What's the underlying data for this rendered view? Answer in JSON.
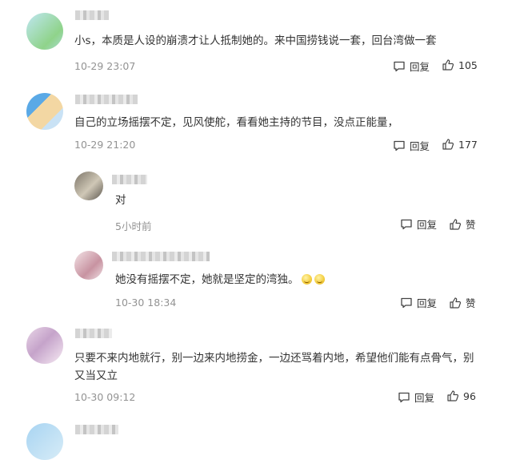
{
  "comments": [
    {
      "text": "小s，本质是人设的崩溃才让人抵制她的。来中国捞钱说一套，回台湾做一套",
      "time": "10-29 23:07",
      "reply_label": "回复",
      "like_value": "105",
      "avatar_colors": [
        "#8fd38a",
        "#bde8f4"
      ]
    },
    {
      "text": "自己的立场摇摆不定，见风使舵，看看她主持的节目，没点正能量，",
      "time": "10-29 21:20",
      "reply_label": "回复",
      "like_value": "177",
      "avatar_colors": [
        "#6fb8ea",
        "#f6d9a8"
      ]
    },
    {
      "text": "对",
      "time": "5小时前",
      "reply_label": "回复",
      "like_value": "赞",
      "avatar_colors": [
        "#9c9488",
        "#e6e1d6"
      ]
    },
    {
      "text": "她没有摇摆不定，她就是坚定的湾独。",
      "time": "10-30 18:34",
      "reply_label": "回复",
      "like_value": "赞",
      "avatar_colors": [
        "#d7a9b4",
        "#f4e7ea"
      ]
    },
    {
      "text": "只要不来内地就行，别一边来内地捞金，一边还骂着内地，希望他们能有点骨气，别又当又立",
      "time": "10-30 09:12",
      "reply_label": "回复",
      "like_value": "96",
      "avatar_colors": [
        "#c7a7cf",
        "#f1e2ef"
      ]
    }
  ]
}
